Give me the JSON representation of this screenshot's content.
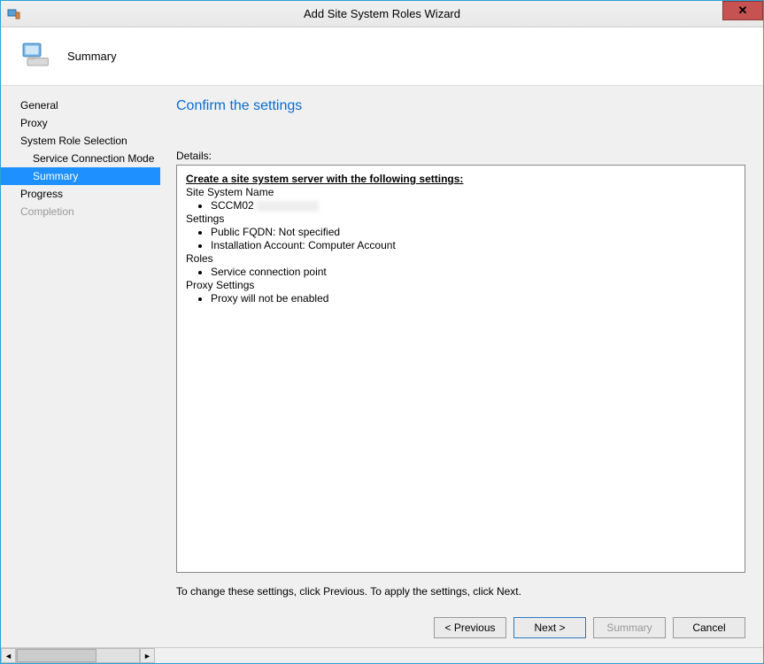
{
  "window": {
    "title": "Add Site System Roles Wizard",
    "close_glyph": "✕"
  },
  "header": {
    "title": "Summary"
  },
  "sidebar": {
    "items": [
      {
        "label": "General",
        "indent": false,
        "selected": false,
        "disabled": false
      },
      {
        "label": "Proxy",
        "indent": false,
        "selected": false,
        "disabled": false
      },
      {
        "label": "System Role Selection",
        "indent": false,
        "selected": false,
        "disabled": false
      },
      {
        "label": "Service Connection Mode",
        "indent": true,
        "selected": false,
        "disabled": false
      },
      {
        "label": "Summary",
        "indent": true,
        "selected": true,
        "disabled": false
      },
      {
        "label": "Progress",
        "indent": false,
        "selected": false,
        "disabled": false
      },
      {
        "label": "Completion",
        "indent": false,
        "selected": false,
        "disabled": true
      }
    ]
  },
  "main": {
    "heading": "Confirm the settings",
    "details_label": "Details:",
    "details": {
      "header": "Create a site system server with the following settings:",
      "sections": [
        {
          "title": "Site System Name",
          "items": [
            "SCCM02"
          ]
        },
        {
          "title": "Settings",
          "items": [
            "Public FQDN: Not specified",
            "Installation Account: Computer Account"
          ]
        },
        {
          "title": "Roles",
          "items": [
            "Service connection point"
          ]
        },
        {
          "title": "Proxy Settings",
          "items": [
            "Proxy will not be enabled"
          ]
        }
      ]
    },
    "hint": "To change these settings, click Previous. To apply the settings, click Next."
  },
  "buttons": {
    "previous": "< Previous",
    "next": "Next >",
    "summary": "Summary",
    "cancel": "Cancel"
  }
}
